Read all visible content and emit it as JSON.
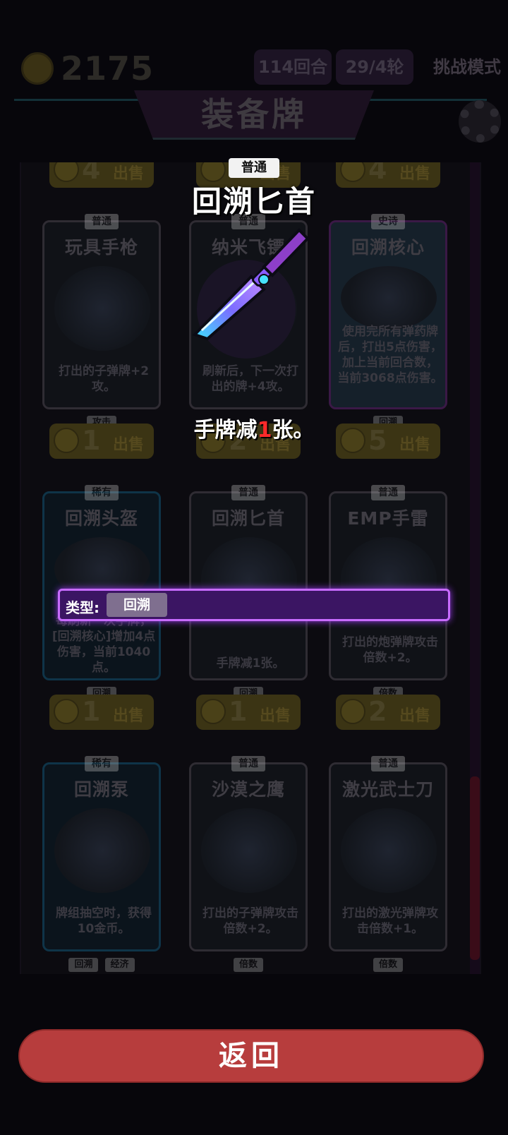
{
  "header": {
    "gold": "2175",
    "round": "114回合",
    "wave": "29/4轮",
    "mode": "挑战模式",
    "title": "装备牌"
  },
  "cards": [
    {
      "rarity": "普通",
      "name": "玩具手枪",
      "desc": "打出的子弹牌+2攻。",
      "tags": [
        "攻击"
      ],
      "cost": "1",
      "sell": "出售"
    },
    {
      "rarity": "普通",
      "name": "纳米飞镖",
      "desc": "刷新后，下一次打出的牌+4攻。",
      "tags": [],
      "cost": "2",
      "sell": "出售"
    },
    {
      "rarity": "史诗",
      "name": "回溯核心",
      "desc": "使用完所有弹药牌后，打出5点伤害，加上当前回合数，当前3068点伤害。",
      "tags": [
        "回溯"
      ],
      "cost": "5",
      "sell": "出售"
    },
    {
      "rarity": "稀有",
      "name": "回溯头盔",
      "desc": "每刷新一次手牌，[回溯核心]增加4点伤害，当前1040点。",
      "tags": [
        "回溯"
      ],
      "cost": "1",
      "sell": "出售"
    },
    {
      "rarity": "普通",
      "name": "回溯匕首",
      "desc": "手牌减1张。",
      "tags": [
        "回溯"
      ],
      "cost": "1",
      "sell": "出售"
    },
    {
      "rarity": "普通",
      "name": "EMP手雷",
      "desc": "打出的炮弹牌攻击倍数+2。",
      "tags": [
        "倍数"
      ],
      "cost": "2",
      "sell": "出售"
    },
    {
      "rarity": "稀有",
      "name": "回溯泵",
      "desc": "牌组抽空时，获得10金币。",
      "tags": [
        "回溯",
        "经济"
      ],
      "cost": "",
      "sell": ""
    },
    {
      "rarity": "普通",
      "name": "沙漠之鹰",
      "desc": "打出的子弹牌攻击倍数+2。",
      "tags": [
        "倍数"
      ],
      "cost": "",
      "sell": ""
    },
    {
      "rarity": "普通",
      "name": "激光武士刀",
      "desc": "打出的激光弹牌攻击倍数+1。",
      "tags": [
        "倍数"
      ],
      "cost": "",
      "sell": ""
    }
  ],
  "top_partial_costs": [
    "4",
    "",
    "4"
  ],
  "top_partial_sell": "出售",
  "detail": {
    "rarity": "普通",
    "name": "回溯匕首",
    "desc_prefix": "手牌减",
    "desc_num": "1",
    "desc_suffix": "张。",
    "type_label": "类型:",
    "type_value": "回溯"
  },
  "back_button": "返回",
  "colors": {
    "back_button": "#b73d3d",
    "type_bar": "#3b1563",
    "type_border": "#c86cff",
    "desc_highlight": "#ff2a2a"
  }
}
